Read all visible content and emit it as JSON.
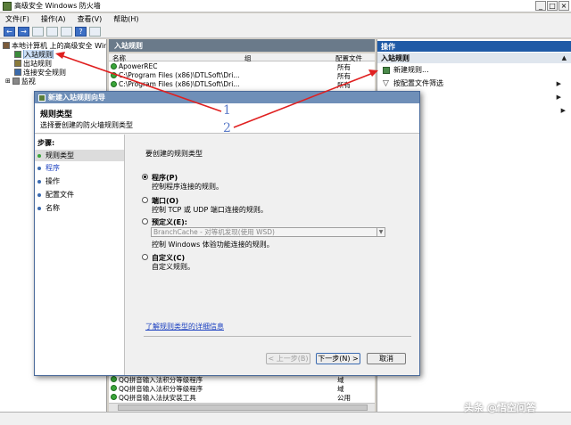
{
  "window": {
    "title": "高级安全 Windows 防火墙",
    "min": "_",
    "max": "□",
    "close": "×"
  },
  "menu": [
    "文件(F)",
    "操作(A)",
    "查看(V)",
    "帮助(H)"
  ],
  "toolbar": {
    "back": "←",
    "forward": "→",
    "help": "?"
  },
  "tree": {
    "root": "本地计算机 上的高级安全 Windows",
    "items": [
      "入站规则",
      "出站规则",
      "连接安全规则",
      "监视"
    ]
  },
  "center": {
    "header": "入站规则",
    "columns": [
      "名称",
      "组",
      "配置文件"
    ],
    "top_rows": [
      {
        "name": "ApowerREC",
        "profile": "所有"
      },
      {
        "name": "C:\\Program Files (x86)\\DTLSoft\\Dri...",
        "profile": "所有"
      },
      {
        "name": "C:\\Program Files (x86)\\DTLSoft\\Dri...",
        "profile": "所有"
      }
    ],
    "bottom_rows": [
      {
        "name": "QQ拼音输入法积分等级程序",
        "profile": "域"
      },
      {
        "name": "QQ拼音输入法积分等级程序",
        "profile": "域"
      },
      {
        "name": "QQ拼音输入法扶安装工具",
        "profile": "公用"
      }
    ]
  },
  "actions": {
    "header": "操作",
    "section": "入站规则",
    "items": [
      "新建规则...",
      "按配置文件筛选",
      "..."
    ]
  },
  "dialog": {
    "title": "新建入站规则向导",
    "heading": "规则类型",
    "subheading": "选择要创建的防火墙规则类型",
    "steps_header": "步骤:",
    "steps": [
      "规则类型",
      "程序",
      "操作",
      "配置文件",
      "名称"
    ],
    "question": "要创建的规则类型",
    "options": [
      {
        "label": "程序(P)",
        "desc": "控制程序连接的规则。",
        "selected": true
      },
      {
        "label": "端口(O)",
        "desc": "控制 TCP 或 UDP 端口连接的规则。",
        "selected": false
      },
      {
        "label": "预定义(E):",
        "desc": "控制 Windows 体验功能连接的规则。",
        "selected": false
      },
      {
        "label": "自定义(C)",
        "desc": "自定义规则。",
        "selected": false
      }
    ],
    "predefined_value": "BranchCache - 对等机发现(使用 WSD)",
    "link": "了解规则类型的详细信息",
    "buttons": {
      "back": "< 上一步(B)",
      "next": "下一步(N) >",
      "cancel": "取消"
    }
  },
  "annotations": [
    "1",
    "2"
  ],
  "watermark": "头条 @悟空问答"
}
